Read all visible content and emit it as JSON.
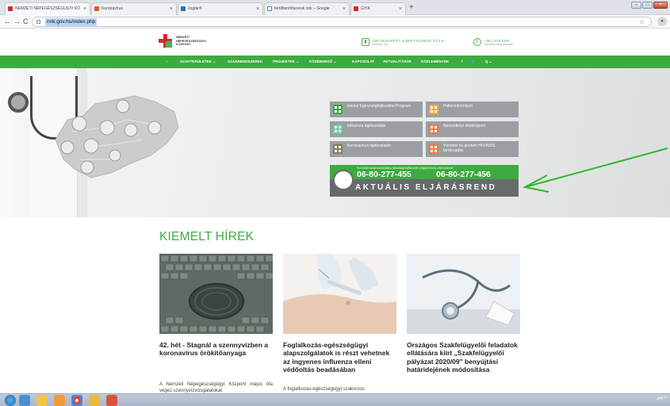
{
  "browser": {
    "tabs": [
      {
        "label": "NEMZETI NÉPEGÉSZSÉGÜGYI KÖ",
        "active": true
      },
      {
        "label": "Koronavírus",
        "active": false
      },
      {
        "label": "Jogtár®",
        "active": false
      },
      {
        "label": "fertőtlenítőszerek nnk – Google ·",
        "active": false
      },
      {
        "label": "GYIK",
        "active": false
      }
    ],
    "new_tab_label": "+",
    "url": "nnk.gov.hu/index.php",
    "back_label": "←",
    "forward_label": "→",
    "reload_label": "C",
    "star_label": "☆"
  },
  "site": {
    "logo_lines": [
      "NEMZETI",
      "NÉPEGÉSZSÉGÜGYI",
      "KÖZPONT"
    ],
    "address": "1097 BUDAPEST, ALBERT FLÓRIÁN ÚT 2-6.",
    "address_sub": "KÖZPONTI CÍM",
    "phone": "+36 1 476 1100",
    "phone_sub": "KÖZPONTI TELEFONSZÁM",
    "nav": [
      {
        "label": "⌂"
      },
      {
        "label": "SZAKTERÜLETEK ⌄"
      },
      {
        "label": "SZAKRENDSZEREK"
      },
      {
        "label": "PROJEKTEK ⌄"
      },
      {
        "label": "KÖZÉRDEKŰ ⌄"
      },
      {
        "label": "KAPCSOLAT"
      },
      {
        "label": "AKTUALITÁSOK"
      },
      {
        "label": "KÖZLEMÉNYEK"
      },
      {
        "label": "f"
      },
      {
        "label": "🐦"
      },
      {
        "label": "Q ⌄"
      }
    ]
  },
  "hero": {
    "menu": [
      {
        "label": "Iskolai Egészségfejlesztési Program",
        "color": "#3dab3f"
      },
      {
        "label": "Polleninformáció",
        "color": "#f3a938"
      },
      {
        "label": "Influenza tájékoztatás",
        "color": "#6fc6a0"
      },
      {
        "label": "Nemzetközi oltóközpont",
        "color": "#f07a3c"
      },
      {
        "label": "Koronavírus tájékoztatók",
        "color": "#8a7a5c"
      },
      {
        "label": "Vérvétel és anonim HIV/AIDS tanácsadás",
        "color": "#f07a3c"
      }
    ],
    "hotline_text": "Koronavírussal kapcsolatos lakossági tájékoztató (ingyenesen) zöld számok:",
    "hotline_1": "06-80-277-455",
    "hotline_2": "06-80-277-456",
    "procedure_button": "AKTUÁLIS ELJÁRÁSREND"
  },
  "news": {
    "heading": "KIEMELT HÍREK",
    "items": [
      {
        "title": "42. hét - Stagnál a szennyvízben a koronavírus örökítőanyaga",
        "body": "A Nemzeti Népegészségügyi Központ május óta végez szennyvízvizsgálatokat"
      },
      {
        "title": "Foglalkozás-egészségügyi alapszolgálatok is részt vehetnek az ingyenes influenza elleni védőoltás beadásában",
        "body": "A foglalkozás-egészségügyi szakorvos"
      },
      {
        "title": "Országos Szakfelügyelői feladatok ellátására kiírt „Szakfelügyelői pályázat 2020/09\" benyújtási határidejének módosítása",
        "body": ""
      }
    ]
  },
  "colors": {
    "brand_green": "#3dab3f",
    "brand_red": "#d8262e",
    "arrow_green": "#2eb82e"
  }
}
